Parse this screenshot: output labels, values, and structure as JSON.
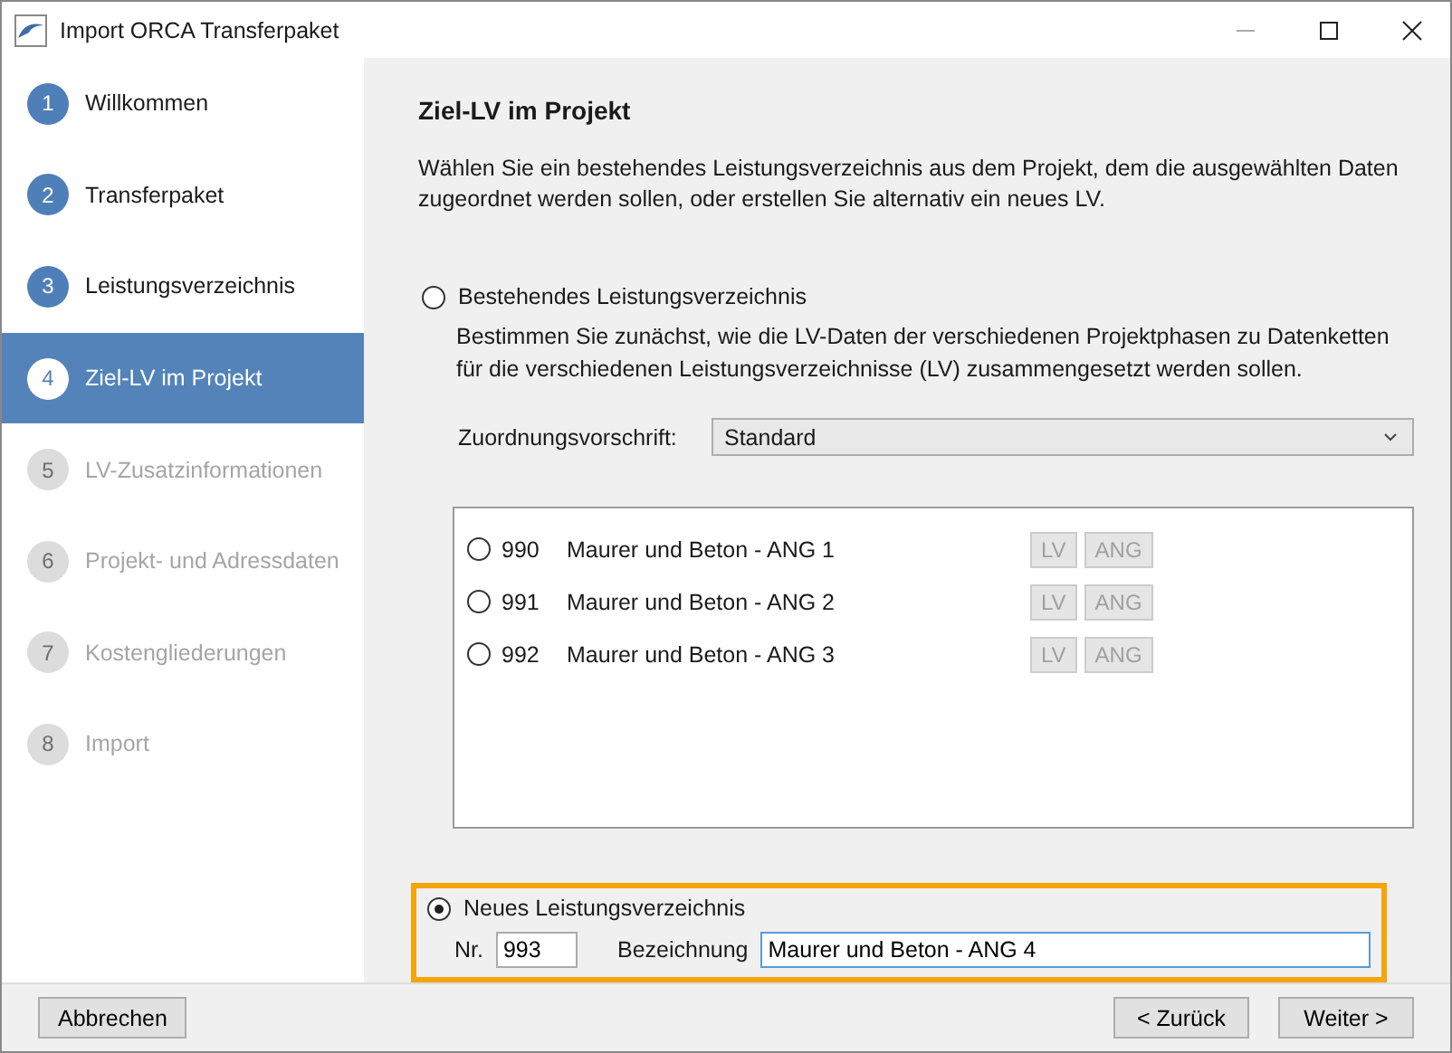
{
  "window": {
    "title": "Import ORCA Transferpaket"
  },
  "steps": [
    {
      "number": "1",
      "label": "Willkommen",
      "selected": false,
      "disabled": false
    },
    {
      "number": "2",
      "label": "Transferpaket",
      "selected": false,
      "disabled": false
    },
    {
      "number": "3",
      "label": "Leistungsverzeichnis",
      "selected": false,
      "disabled": false
    },
    {
      "number": "4",
      "label": "Ziel-LV im Projekt",
      "selected": true,
      "disabled": false
    },
    {
      "number": "5",
      "label": "LV-Zusatzinformationen",
      "selected": false,
      "disabled": true
    },
    {
      "number": "6",
      "label": "Projekt- und Adressdaten",
      "selected": false,
      "disabled": true
    },
    {
      "number": "7",
      "label": "Kostengliederungen",
      "selected": false,
      "disabled": true
    },
    {
      "number": "8",
      "label": "Import",
      "selected": false,
      "disabled": true
    }
  ],
  "page": {
    "heading": "Ziel-LV im Projekt",
    "intro": "Wählen Sie ein bestehendes Leistungsverzeichnis aus dem Projekt, dem die ausgewählten Daten zugeordnet werden sollen, oder erstellen Sie alternativ ein neues LV."
  },
  "existing": {
    "label": "Bestehendes Leistungsverzeichnis",
    "selected": false,
    "description": "Bestimmen Sie zunächst, wie die LV-Daten der verschiedenen Projektphasen zu Datenketten für die verschiedenen Leistungsverzeichnisse (LV) zusammengesetzt werden sollen.",
    "rule_label": "Zuordnungsvorschrift:",
    "rule_value": "Standard",
    "items": [
      {
        "number": "990",
        "name": "Maurer und Beton - ANG 1",
        "selected": false,
        "buttons": [
          {
            "label": "LV",
            "disabled": true
          },
          {
            "label": "ANG",
            "disabled": true
          }
        ]
      },
      {
        "number": "991",
        "name": "Maurer und Beton - ANG 2",
        "selected": false,
        "buttons": [
          {
            "label": "LV",
            "disabled": true
          },
          {
            "label": "ANG",
            "disabled": true
          }
        ]
      },
      {
        "number": "992",
        "name": "Maurer und Beton - ANG 3",
        "selected": false,
        "buttons": [
          {
            "label": "LV",
            "disabled": true
          },
          {
            "label": "ANG",
            "disabled": true
          }
        ]
      }
    ]
  },
  "new_lv": {
    "label": "Neues Leistungsverzeichnis",
    "selected": true,
    "highlighted": true,
    "nr_label": "Nr.",
    "nr_value": "993",
    "name_label": "Bezeichnung",
    "name_value": "Maurer und Beton - ANG 4"
  },
  "footer": {
    "cancel": "Abbrechen",
    "back": "< Zurück",
    "next": "Weiter >"
  }
}
